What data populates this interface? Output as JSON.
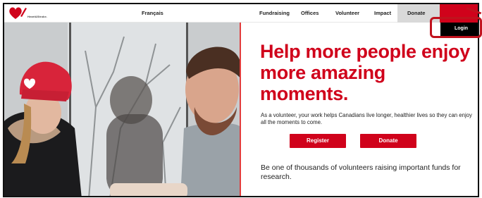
{
  "nav": {
    "language": "Français",
    "items": [
      "Fundraising",
      "Offices",
      "Volunteer",
      "Impact"
    ],
    "donate": "Donate",
    "login": "Login"
  },
  "logo": {
    "wordmark": "Heart&Stroke."
  },
  "hero": {
    "headline": "Help more people enjoy more amazing moments.",
    "subtext": "As a volunteer, your work helps Canadians live longer, healthier lives so they can enjoy all the moments to come.",
    "register_label": "Register",
    "donate_label": "Donate",
    "paragraph": "Be one of thousands of volunteers raising important funds for research."
  },
  "colors": {
    "brand_red": "#d0021b",
    "nav_gray": "#d9d9d9",
    "callout_red": "#c0121d"
  }
}
